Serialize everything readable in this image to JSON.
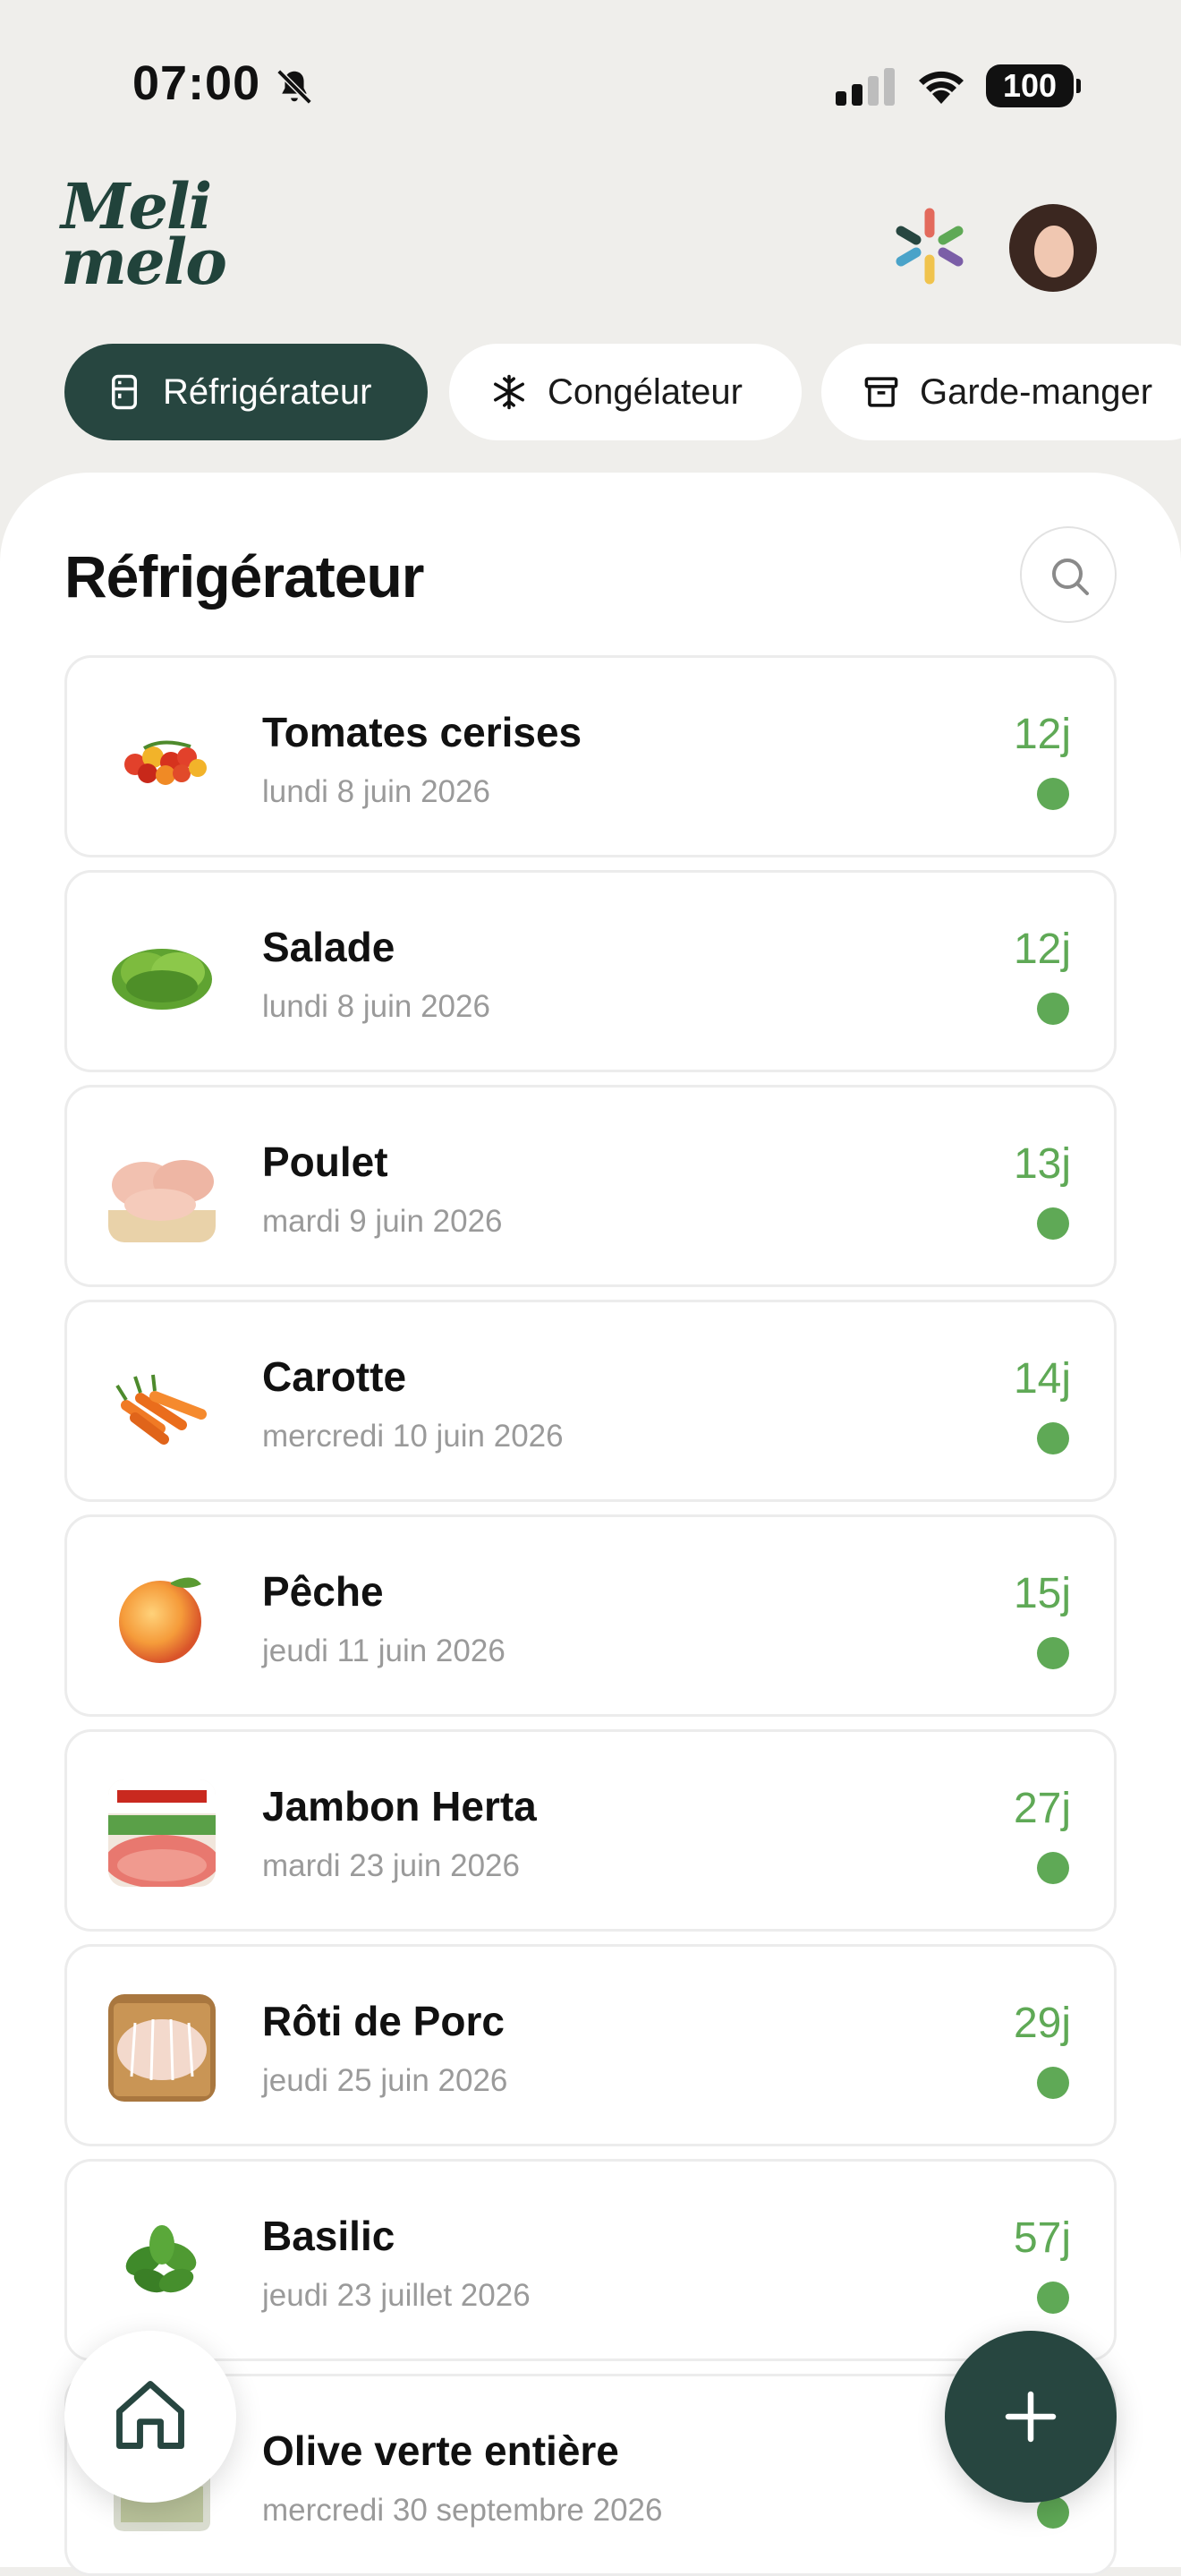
{
  "status_bar": {
    "time": "07:00",
    "battery": "100"
  },
  "header": {
    "logo_line1": "Meli",
    "logo_line2": "melo"
  },
  "tabs": [
    {
      "label": "Réfrigérateur",
      "icon": "fridge-icon",
      "active": true
    },
    {
      "label": "Congélateur",
      "icon": "snowflake-icon",
      "active": false
    },
    {
      "label": "Garde-manger",
      "icon": "archive-box-icon",
      "active": false
    }
  ],
  "section": {
    "title": "Réfrigérateur"
  },
  "items": [
    {
      "name": "Tomates cerises",
      "date": "lundi 8 juin 2026",
      "days": "12j",
      "thumb": "cherry-tomatoes"
    },
    {
      "name": "Salade",
      "date": "lundi 8 juin 2026",
      "days": "12j",
      "thumb": "lettuce"
    },
    {
      "name": "Poulet",
      "date": "mardi 9 juin 2026",
      "days": "13j",
      "thumb": "chicken"
    },
    {
      "name": "Carotte",
      "date": "mercredi 10 juin 2026",
      "days": "14j",
      "thumb": "carrots"
    },
    {
      "name": "Pêche",
      "date": "jeudi 11 juin 2026",
      "days": "15j",
      "thumb": "peach"
    },
    {
      "name": "Jambon Herta",
      "date": "mardi 23 juin 2026",
      "days": "27j",
      "thumb": "ham-pack"
    },
    {
      "name": "Rôti de Porc",
      "date": "jeudi 25 juin 2026",
      "days": "29j",
      "thumb": "pork-roast"
    },
    {
      "name": "Basilic",
      "date": "jeudi 23 juillet 2026",
      "days": "57j",
      "thumb": "basil"
    },
    {
      "name": "Olive verte entière",
      "date": "mercredi 30 septembre 2026",
      "days": "",
      "thumb": "olive-jar"
    }
  ],
  "colors": {
    "accent": "#274640",
    "fresh": "#5fa956",
    "background": "#efeeeb"
  }
}
